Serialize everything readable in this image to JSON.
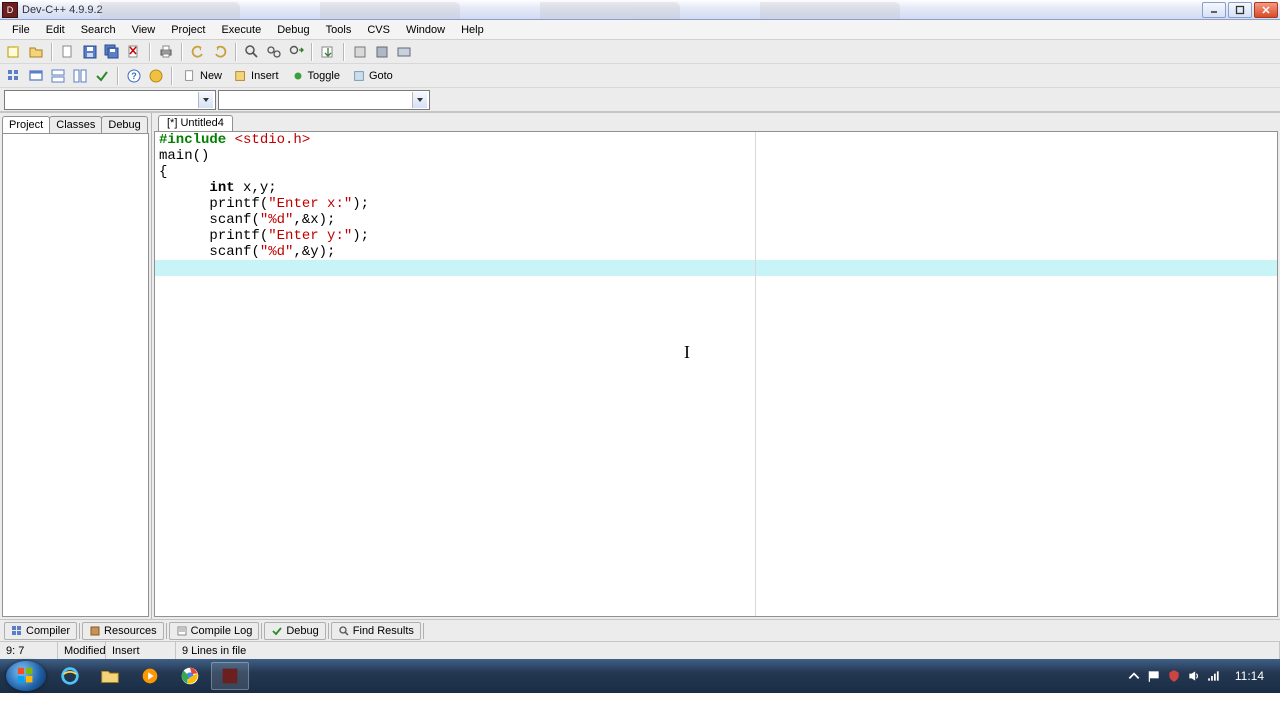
{
  "title": "Dev-C++ 4.9.9.2",
  "menu": [
    "File",
    "Edit",
    "Search",
    "View",
    "Project",
    "Execute",
    "Debug",
    "Tools",
    "CVS",
    "Window",
    "Help"
  ],
  "toolbar2_labels": {
    "new": "New",
    "insert": "Insert",
    "toggle": "Toggle",
    "goto": "Goto"
  },
  "left_tabs": [
    "Project",
    "Classes",
    "Debug"
  ],
  "file_tab": "[*] Untitled4",
  "code": [
    {
      "pre": "",
      "segs": [
        {
          "t": "#include ",
          "c": "kw-green"
        },
        {
          "t": "<stdio.h>",
          "c": "str"
        }
      ]
    },
    {
      "pre": "",
      "segs": [
        {
          "t": "main",
          "c": ""
        },
        {
          "t": "()",
          "c": ""
        }
      ]
    },
    {
      "pre": "",
      "segs": [
        {
          "t": "{",
          "c": ""
        }
      ]
    },
    {
      "pre": "      ",
      "segs": [
        {
          "t": "int",
          "c": "kw-bold"
        },
        {
          "t": " x,y;",
          "c": ""
        }
      ]
    },
    {
      "pre": "      ",
      "segs": [
        {
          "t": "printf",
          "c": ""
        },
        {
          "t": "(",
          "c": ""
        },
        {
          "t": "\"Enter x:\"",
          "c": "str"
        },
        {
          "t": ");",
          "c": ""
        }
      ]
    },
    {
      "pre": "      ",
      "segs": [
        {
          "t": "scanf",
          "c": ""
        },
        {
          "t": "(",
          "c": ""
        },
        {
          "t": "\"%d\"",
          "c": "str"
        },
        {
          "t": ",&x);",
          "c": ""
        }
      ]
    },
    {
      "pre": "      ",
      "segs": [
        {
          "t": "printf",
          "c": ""
        },
        {
          "t": "(",
          "c": ""
        },
        {
          "t": "\"Enter y:\"",
          "c": "str"
        },
        {
          "t": ");",
          "c": ""
        }
      ]
    },
    {
      "pre": "      ",
      "segs": [
        {
          "t": "scanf",
          "c": ""
        },
        {
          "t": "(",
          "c": ""
        },
        {
          "t": "\"%d\"",
          "c": "str"
        },
        {
          "t": ",&y);",
          "c": ""
        }
      ]
    },
    {
      "pre": "      ",
      "segs": [],
      "hl": true
    }
  ],
  "bottom_tabs": [
    "Compiler",
    "Resources",
    "Compile Log",
    "Debug",
    "Find Results"
  ],
  "status": {
    "pos": "9: 7",
    "modified": "Modified",
    "mode": "Insert",
    "lines": "9 Lines in file"
  },
  "clock": "11:14"
}
